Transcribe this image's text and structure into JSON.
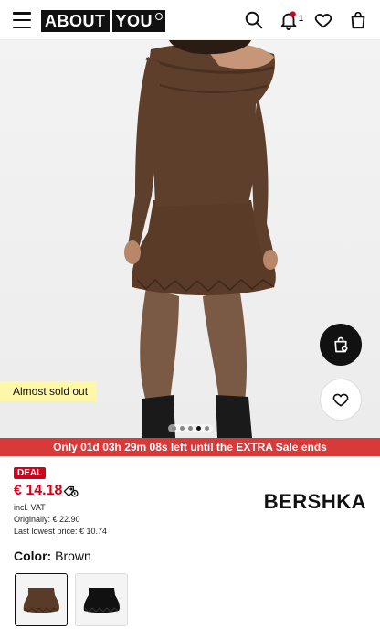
{
  "header": {
    "logo_about": "ABOUT",
    "logo_you": "YOU",
    "notification_count": "1",
    "icons": [
      "menu-icon",
      "search-icon",
      "bell-icon",
      "heart-icon",
      "bag-icon"
    ]
  },
  "hero": {
    "stock_badge": "Almost sold out",
    "gallery_total": 5,
    "gallery_active": 4,
    "buttons": [
      "add-to-bag-icon",
      "heart-icon"
    ]
  },
  "sale_banner": {
    "text": "Only 01d 03h 29m 08s left until the EXTRA Sale ends"
  },
  "product": {
    "deal_badge": "DEAL",
    "price": "€ 14.18",
    "vat": "incl. VAT",
    "original_price": "Originally: € 22.90",
    "lowest_price": "Last lowest price: € 10.74",
    "brand": "BERSHKA"
  },
  "color": {
    "label": "Color:",
    "value": "Brown",
    "swatches": [
      {
        "name": "Brown",
        "selected": true
      },
      {
        "name": "Black",
        "selected": false
      }
    ]
  },
  "colors": {
    "accent_red": "#d0021b",
    "banner_red": "#d83a3a",
    "badge_yellow": "#fff7a8",
    "product_brown": "#5a3b28"
  }
}
